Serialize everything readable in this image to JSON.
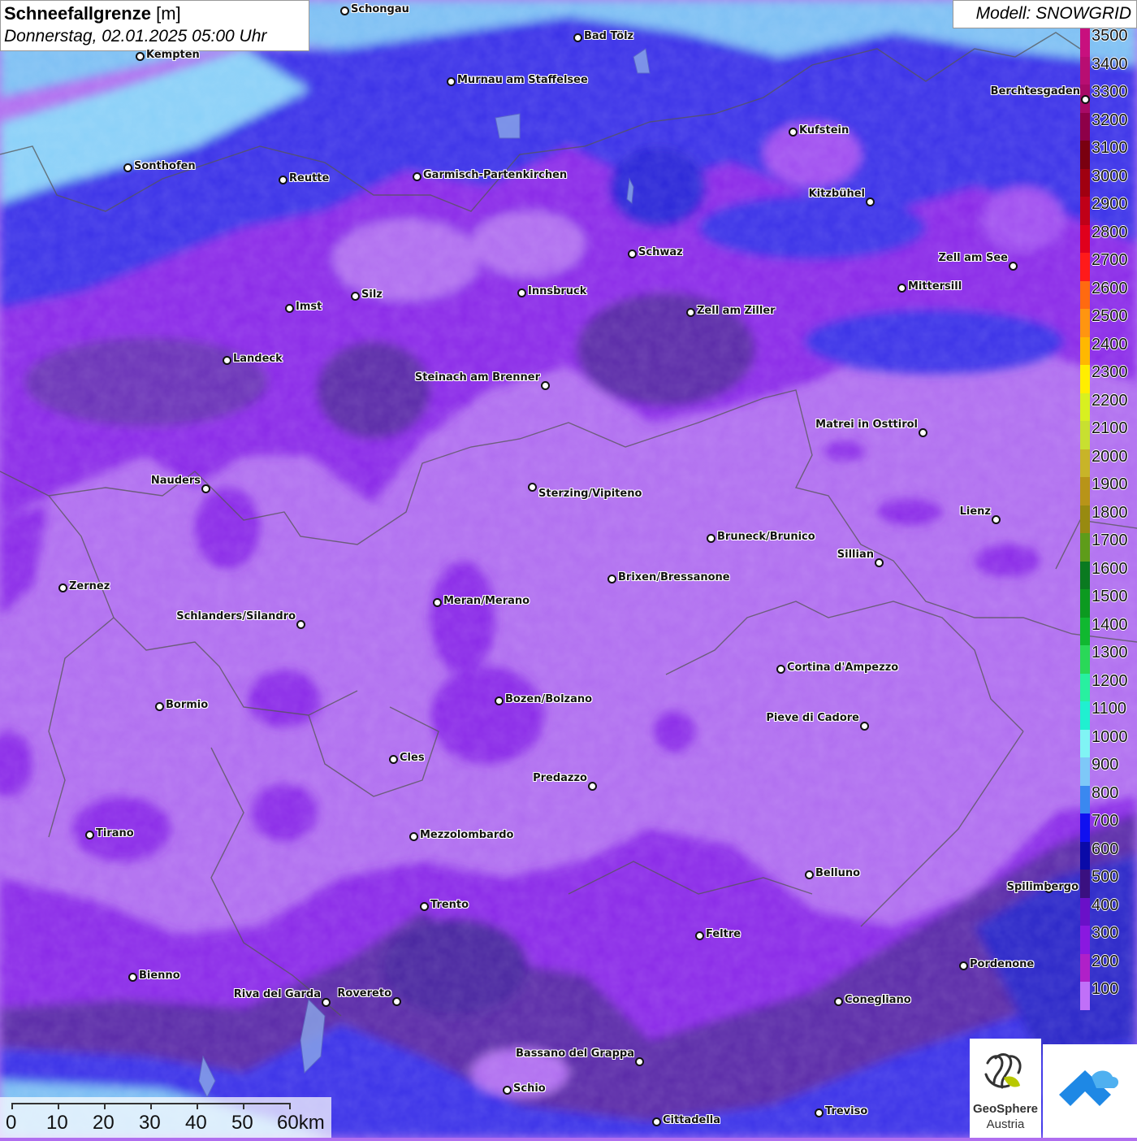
{
  "title": {
    "variable": "Schneefallgrenze",
    "unit": "[m]",
    "datetime": "Donnerstag, 02.01.2025 05:00 Uhr"
  },
  "model_label": "Modell: SNOWGRID",
  "legend": [
    {
      "label": "3500",
      "color": "#c8107e"
    },
    {
      "label": "3400",
      "color": "#b80e72"
    },
    {
      "label": "3300",
      "color": "#a80a66"
    },
    {
      "label": "3200",
      "color": "#8e0048"
    },
    {
      "label": "3100",
      "color": "#7a0010"
    },
    {
      "label": "3000",
      "color": "#a00010"
    },
    {
      "label": "2900",
      "color": "#c00018"
    },
    {
      "label": "2800",
      "color": "#e0001c"
    },
    {
      "label": "2700",
      "color": "#ff1a1a"
    },
    {
      "label": "2600",
      "color": "#ff6a10"
    },
    {
      "label": "2500",
      "color": "#ff9510"
    },
    {
      "label": "2400",
      "color": "#ffb800"
    },
    {
      "label": "2300",
      "color": "#ffee00"
    },
    {
      "label": "2200",
      "color": "#d8f020"
    },
    {
      "label": "2100",
      "color": "#c8e030"
    },
    {
      "label": "2000",
      "color": "#c8b428"
    },
    {
      "label": "1900",
      "color": "#b89418"
    },
    {
      "label": "1800",
      "color": "#988a10"
    },
    {
      "label": "1700",
      "color": "#5e9c1a"
    },
    {
      "label": "1600",
      "color": "#0a7a20"
    },
    {
      "label": "1500",
      "color": "#0c9a20"
    },
    {
      "label": "1400",
      "color": "#10b830"
    },
    {
      "label": "1300",
      "color": "#2ad858"
    },
    {
      "label": "1200",
      "color": "#28f0a0"
    },
    {
      "label": "1100",
      "color": "#20f0d0"
    },
    {
      "label": "1000",
      "color": "#80f4f4"
    },
    {
      "label": "900",
      "color": "#7ec8f8"
    },
    {
      "label": "800",
      "color": "#3a88f0"
    },
    {
      "label": "700",
      "color": "#1010f0"
    },
    {
      "label": "600",
      "color": "#0a0aa8"
    },
    {
      "label": "500",
      "color": "#3a1080"
    },
    {
      "label": "400",
      "color": "#6a10c8"
    },
    {
      "label": "300",
      "color": "#8a18e0"
    },
    {
      "label": "200",
      "color": "#b020c8"
    },
    {
      "label": "100",
      "color": "#c070f8"
    }
  ],
  "cities": [
    {
      "name": "Schongau"
    },
    {
      "name": "Kempten"
    },
    {
      "name": "Bad Tölz"
    },
    {
      "name": "Murnau am Staffelsee"
    },
    {
      "name": "Sonthofen"
    },
    {
      "name": "Reutte"
    },
    {
      "name": "Garmisch-Partenkirchen"
    },
    {
      "name": "Kufstein"
    },
    {
      "name": "Berchtesgaden"
    },
    {
      "name": "Kitzbühel"
    },
    {
      "name": "Schwaz"
    },
    {
      "name": "Zell am See"
    },
    {
      "name": "Innsbruck"
    },
    {
      "name": "Silz"
    },
    {
      "name": "Imst"
    },
    {
      "name": "Mittersill"
    },
    {
      "name": "Zell am Ziller"
    },
    {
      "name": "Landeck"
    },
    {
      "name": "Steinach am Brenner"
    },
    {
      "name": "Matrei in Osttirol"
    },
    {
      "name": "Nauders"
    },
    {
      "name": "Sterzing/Vipiteno"
    },
    {
      "name": "Lienz"
    },
    {
      "name": "Bruneck/Brunico"
    },
    {
      "name": "Sillian"
    },
    {
      "name": "Brixen/Bressanone"
    },
    {
      "name": "Zernez"
    },
    {
      "name": "Meran/Merano"
    },
    {
      "name": "Schlanders/Silandro"
    },
    {
      "name": "Cortina d'Ampezzo"
    },
    {
      "name": "Bozen/Bolzano"
    },
    {
      "name": "Bormio"
    },
    {
      "name": "Pieve di Cadore"
    },
    {
      "name": "Cles"
    },
    {
      "name": "Predazzo"
    },
    {
      "name": "Tirano"
    },
    {
      "name": "Mezzolombardo"
    },
    {
      "name": "Belluno"
    },
    {
      "name": "Spilimbergo"
    },
    {
      "name": "Trento"
    },
    {
      "name": "Feltre"
    },
    {
      "name": "Pordenone"
    },
    {
      "name": "Bienno"
    },
    {
      "name": "Riva del Garda"
    },
    {
      "name": "Rovereto"
    },
    {
      "name": "Conegliano"
    },
    {
      "name": "Bassano del Grappa"
    },
    {
      "name": "Schio"
    },
    {
      "name": "Treviso"
    },
    {
      "name": "Cittadella"
    }
  ],
  "scale": {
    "labels": [
      "0",
      "10",
      "20",
      "30",
      "40",
      "50",
      "60km"
    ]
  },
  "logos": {
    "geosphere_line1": "GeoSphere",
    "geosphere_line2": "Austria"
  },
  "colors": {
    "lowland_lilac": "#b06ef0",
    "purple": "#8a2ae8",
    "dark_purple": "#5a2aa8",
    "blue": "#3a30e8",
    "light_blue": "#7ec0f4"
  }
}
